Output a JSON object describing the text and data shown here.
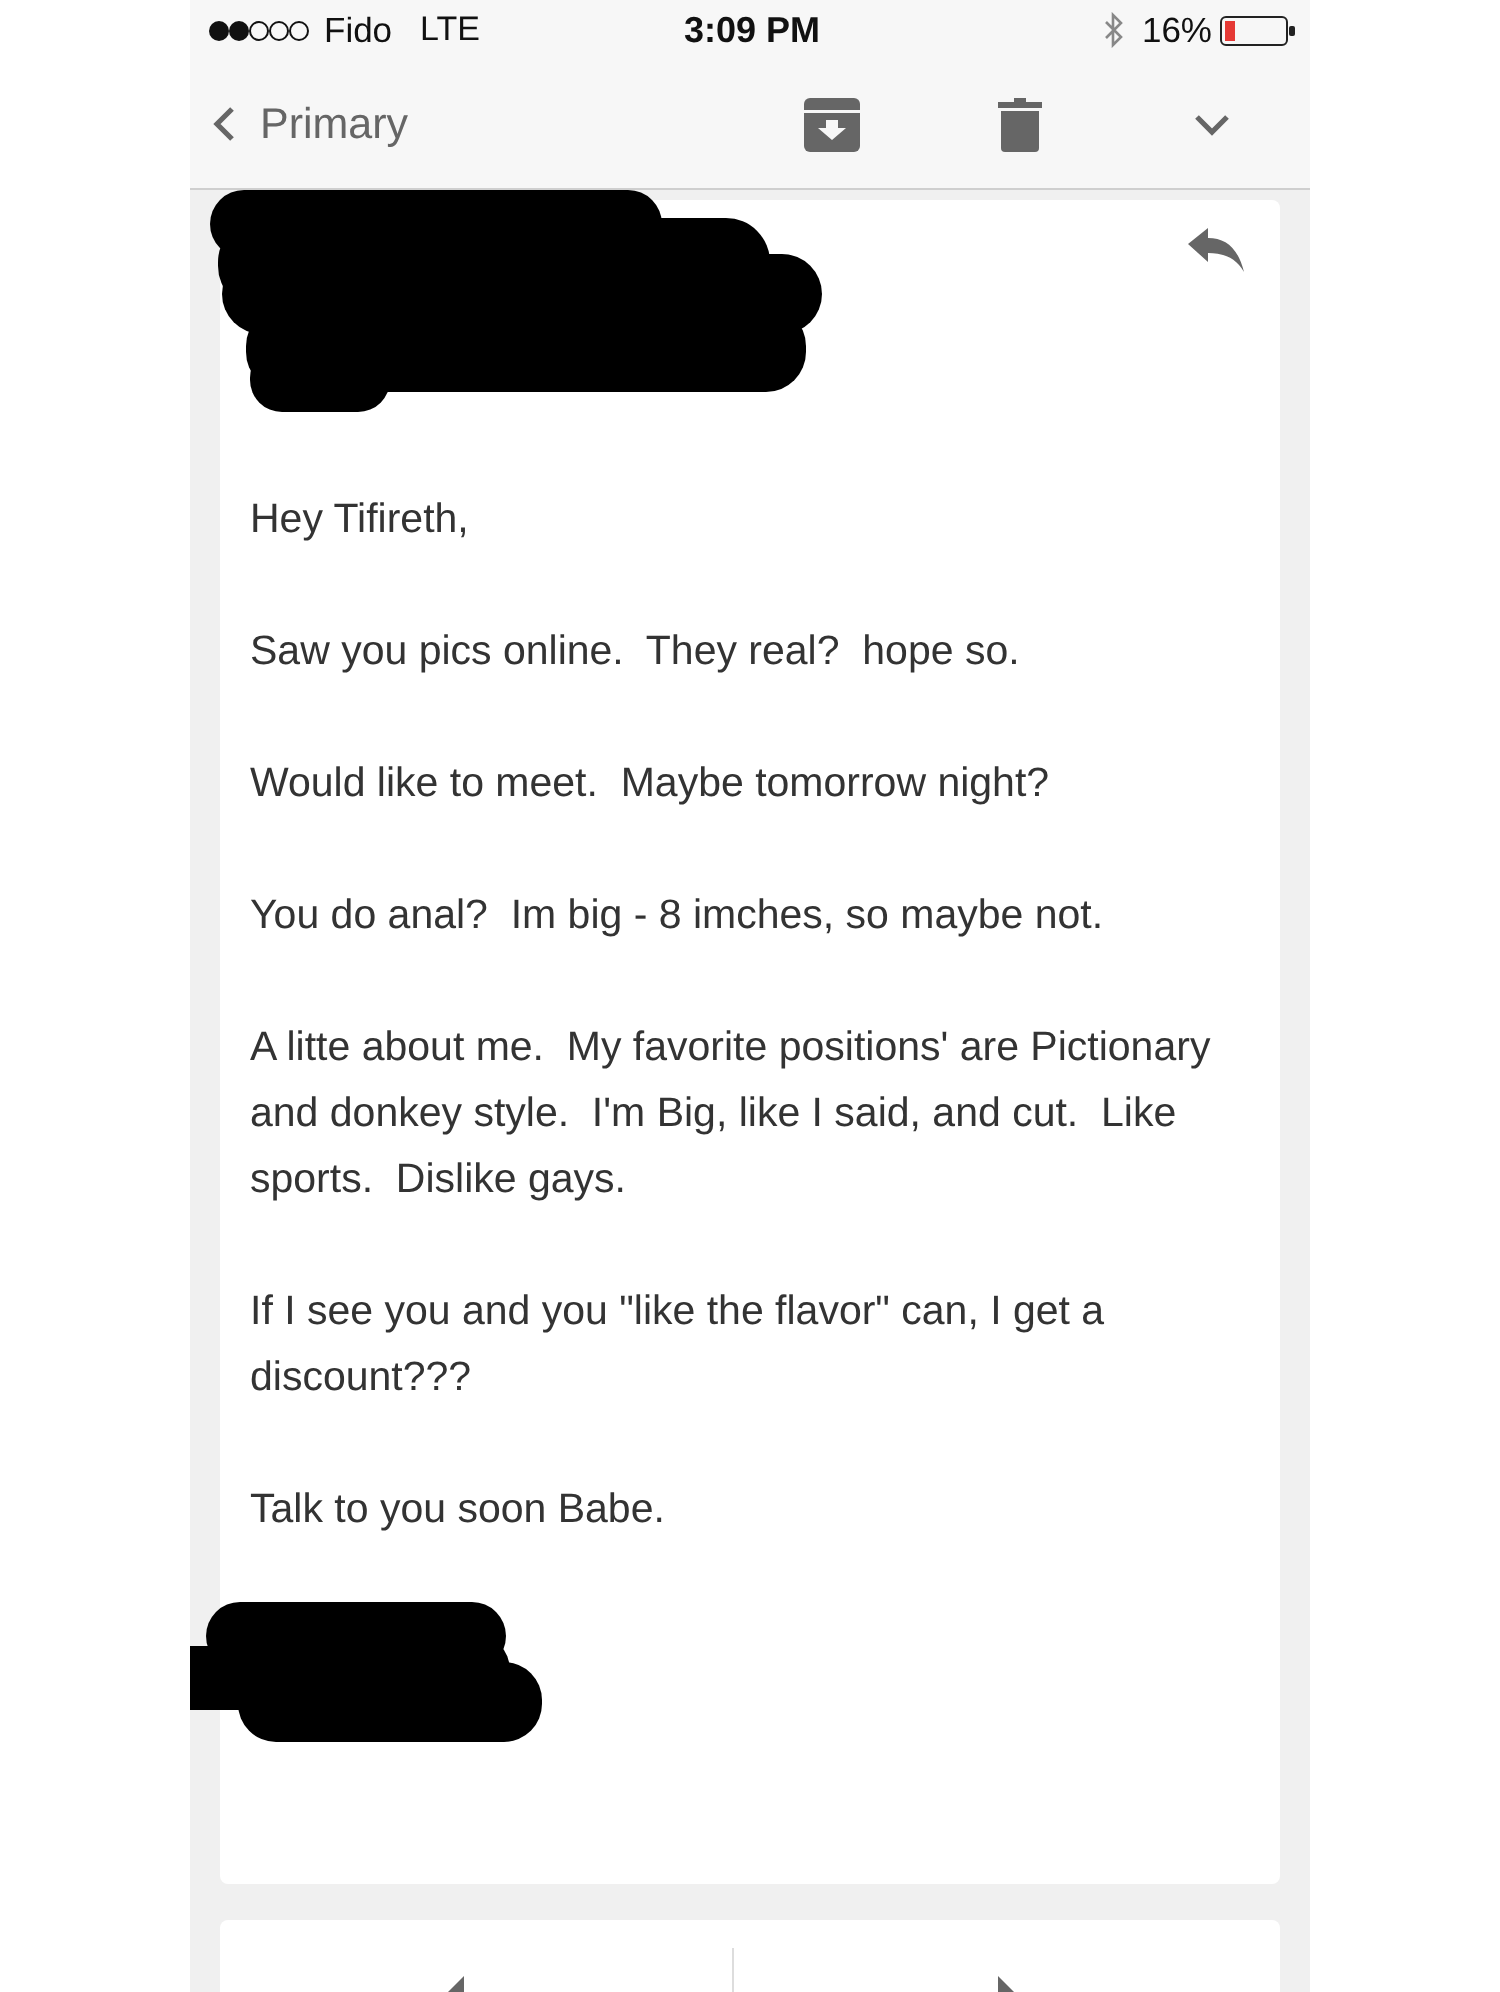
{
  "status_bar": {
    "carrier": "Fido",
    "network": "LTE",
    "time": "3:09 PM",
    "battery": "16%"
  },
  "nav_bar": {
    "back_label": "Primary"
  },
  "message": {
    "paragraphs": [
      "Hey Tifireth,",
      "Saw you pics online.  They real?  hope so.",
      "Would like to meet.  Maybe tomorrow night?",
      "You do anal?  Im big - 8 imches, so maybe not.",
      "A litte about me.  My favorite positions' are Pictionary and donkey style.  I'm Big, like I said, and cut.  Like sports.  Dislike gays.",
      "If I see you and you \"like the flavor\" can, I get a discount???",
      "Talk to you soon Babe."
    ]
  }
}
